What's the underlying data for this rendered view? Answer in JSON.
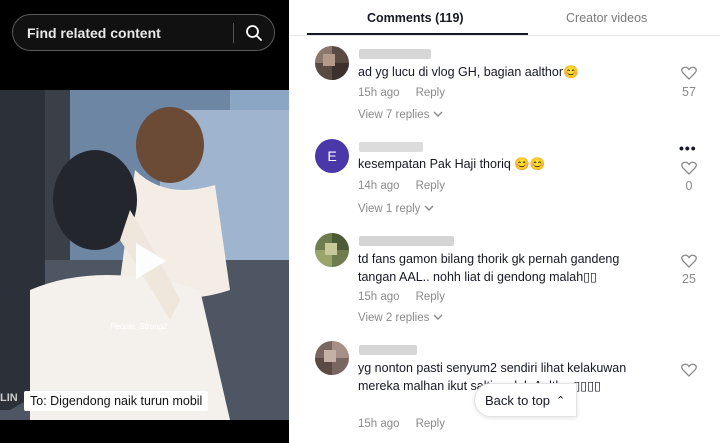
{
  "search": {
    "label": "Find related content"
  },
  "video": {
    "caption": "To: Digendong naik turun mobil",
    "watermark": "People_Strong2",
    "corner_text": "LIN"
  },
  "tabs": [
    {
      "label": "Comments (119)"
    },
    {
      "label": "Creator videos"
    }
  ],
  "comments": [
    {
      "text": "ad yg lucu di vlog GH, bagian aalthor😊",
      "time": "15h ago",
      "reply": "Reply",
      "likes": "57",
      "view_replies": "View 7 replies",
      "avatar_letter": ""
    },
    {
      "text": "kesempatan Pak Haji thoriq 😊😊",
      "time": "14h ago",
      "reply": "Reply",
      "likes": "0",
      "view_replies": "View 1 reply",
      "avatar_letter": "E",
      "avatar_color": "#4a37a8"
    },
    {
      "text": "td fans gamon bilang thorik gk pernah gandeng tangan AAL.. nohh liat di gendong malah▯▯",
      "time": "15h ago",
      "reply": "Reply",
      "likes": "25",
      "view_replies": "View 2 replies",
      "avatar_letter": ""
    },
    {
      "text": "yg nonton pasti senyum2 sendiri lihat kelakuwan mereka malhan ikut salting deh Aalthor▯▯▯▯",
      "time": "15h ago",
      "reply": "Reply",
      "likes": "",
      "view_replies": "",
      "avatar_letter": ""
    }
  ],
  "more": "•••",
  "back_to_top": {
    "label": "Back to top",
    "arrow": "⌃"
  },
  "colors": {
    "accent": "#161823",
    "muted": "#8a8a8a",
    "avatar_e": "#4a37a8"
  }
}
